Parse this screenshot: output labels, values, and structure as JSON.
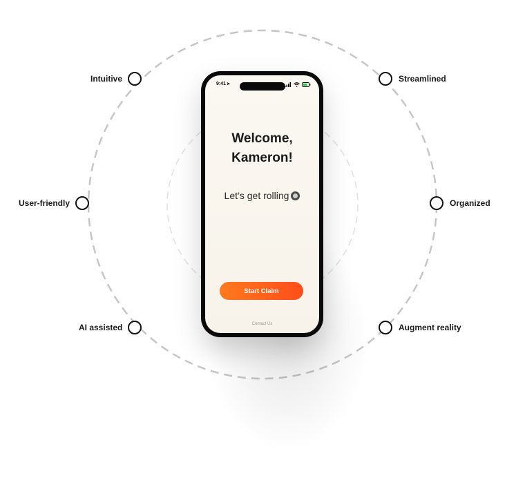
{
  "features": {
    "intuitive": "Intuitive",
    "streamlined": "Streamlined",
    "user_friendly": "User-friendly",
    "organized": "Organized",
    "ai_assisted": "AI assisted",
    "augment_reality": "Augment reality"
  },
  "phone": {
    "status_time": "9:41",
    "welcome_line1": "Welcome,",
    "welcome_line2": "Kameron!",
    "subline": "Let’s get rolling",
    "start_button": "Start Claim",
    "contact_link": "Contact Us"
  },
  "colors": {
    "accent_start": "#ff7a1e",
    "accent_end": "#ff4d1a",
    "ring": "#c8c8c8",
    "node": "#111111"
  }
}
